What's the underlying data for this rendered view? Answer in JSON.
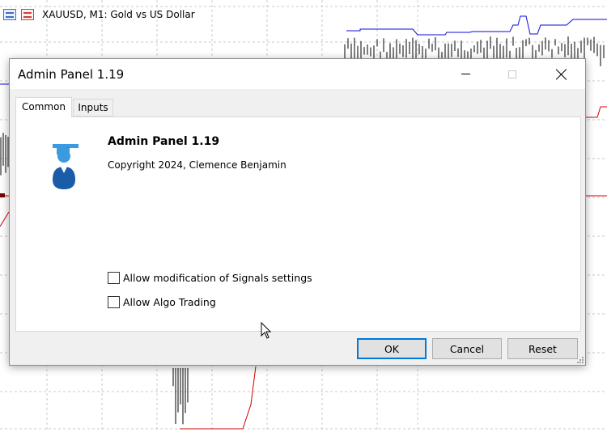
{
  "chart": {
    "symbol_line": "XAUUSD, M1:  Gold vs US Dollar",
    "colors": {
      "upper_band": "#0b0bd6",
      "lower_band": "#d40000",
      "grid": "#c8c8c8",
      "bars": "#000000"
    }
  },
  "dialog": {
    "title": "Admin Panel  1.19",
    "tabs": [
      "Common",
      "Inputs"
    ],
    "active_tab": "Common",
    "app_name": "Admin Panel  1.19",
    "copyright": "Copyright 2024, Clemence Benjamin",
    "options": [
      {
        "label": "Allow modification of Signals settings",
        "checked": false
      },
      {
        "label": "Allow Algo Trading",
        "checked": false
      }
    ],
    "buttons": {
      "ok": "OK",
      "cancel": "Cancel",
      "reset": "Reset"
    }
  },
  "icons": [
    "list-icon",
    "chart-icon",
    "minimize-icon",
    "maximize-icon",
    "close-icon",
    "app-logo-icon",
    "mouse-cursor-icon",
    "resize-grip-icon"
  ]
}
